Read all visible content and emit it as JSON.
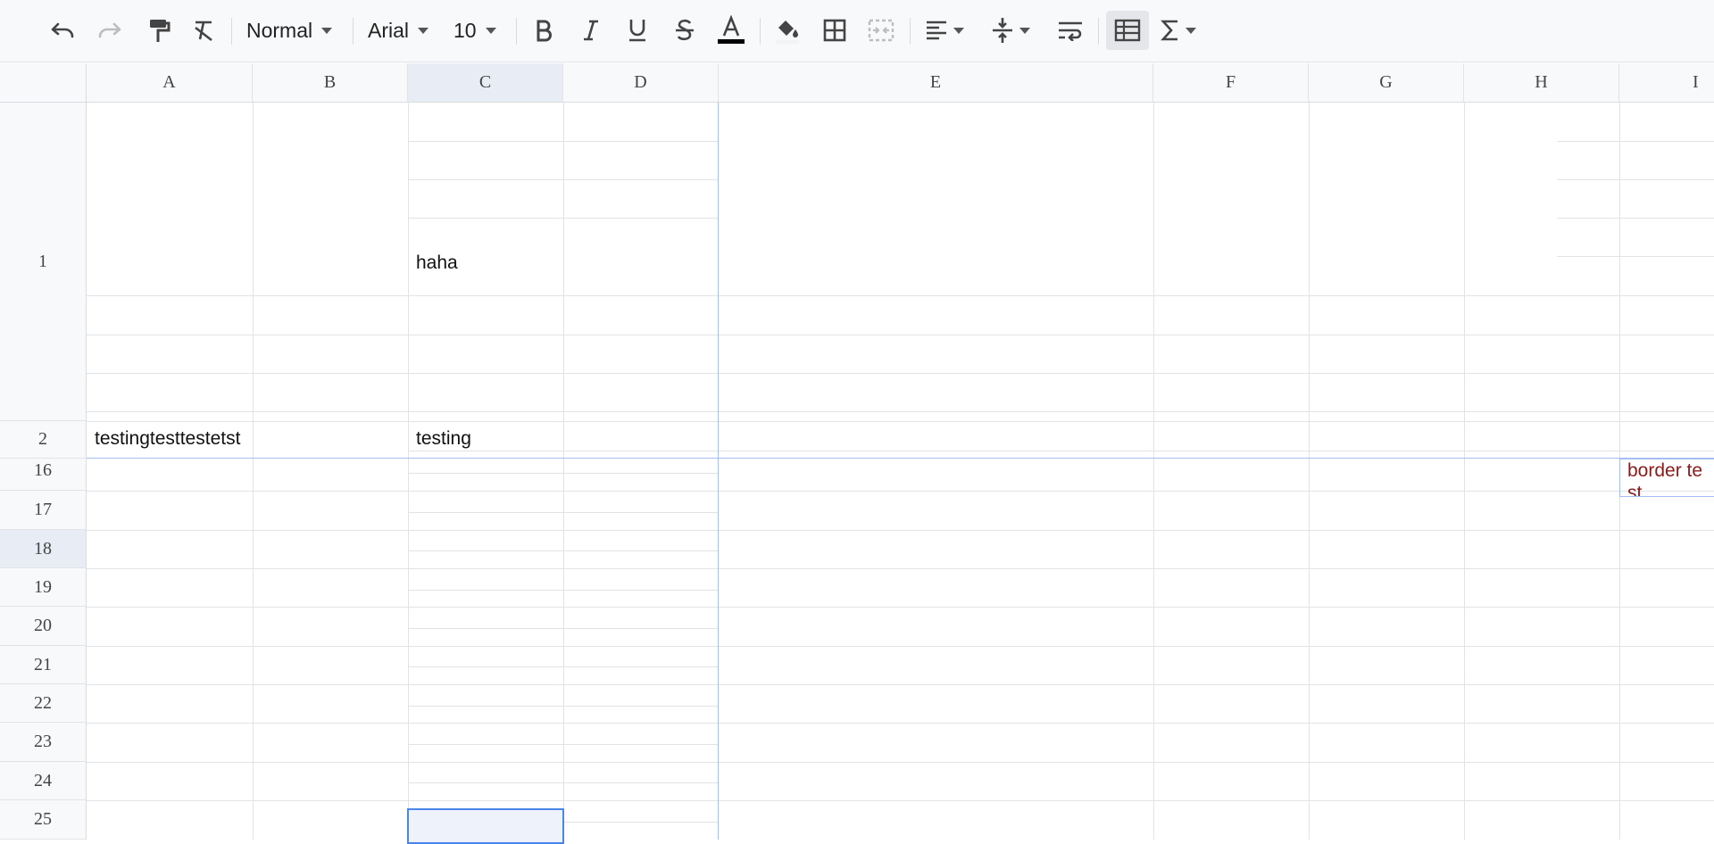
{
  "toolbar": {
    "style_select": "Normal",
    "font_family": "Arial",
    "font_size": "10"
  },
  "columns": [
    "A",
    "B",
    "C",
    "D",
    "E",
    "F",
    "G",
    "H",
    "I"
  ],
  "rows": [
    "1",
    "2",
    "16",
    "17",
    "18",
    "19",
    "20",
    "21",
    "22",
    "23",
    "24",
    "25"
  ],
  "cells": {
    "A2": "testingtesttestetst",
    "C1": "haha",
    "C2": "testing",
    "I16": "border test"
  },
  "selected_cell": "C25",
  "colors": {
    "accent": "#4a86e8",
    "freeze_line": "#a5bdf2",
    "border_test_text": "#8b1a1a"
  }
}
